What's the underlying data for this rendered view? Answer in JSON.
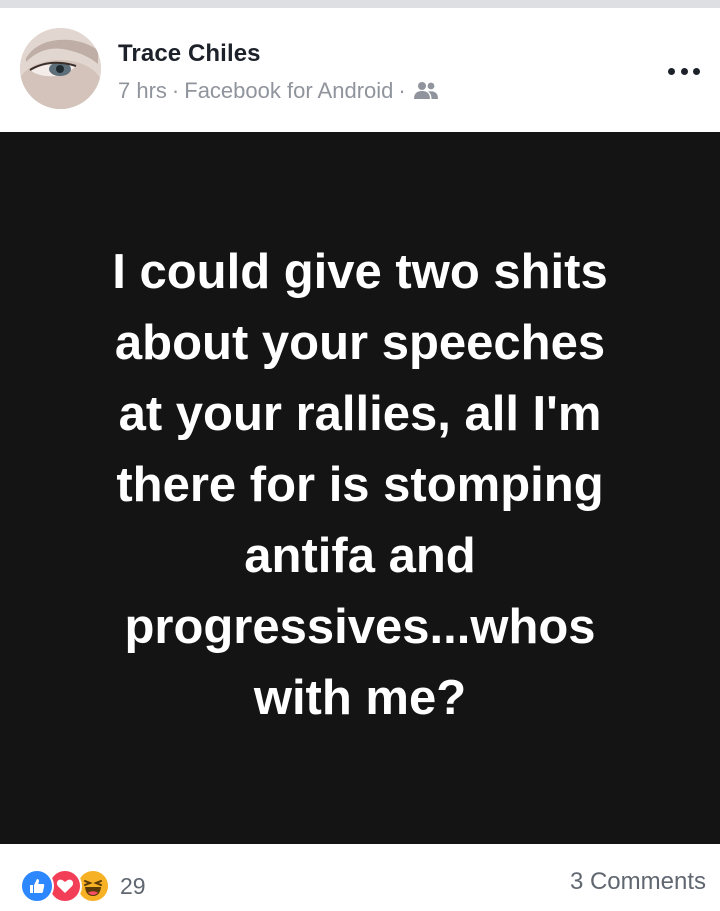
{
  "post": {
    "author_name": "Trace Chiles",
    "time": "7 hrs",
    "separator": "·",
    "source": "Facebook for Android",
    "audience_icon": "friends-icon",
    "more_icon": "more-options-icon",
    "text_lines": [
      "I could give two shits",
      "about your speeches",
      "at your rallies, all I'm",
      "there for is stomping",
      "antifa and",
      "progressives...whos",
      "with me?"
    ],
    "background_color": "#141414",
    "text_color": "#ffffff"
  },
  "footer": {
    "reactions": [
      "like-icon",
      "love-icon",
      "haha-icon"
    ],
    "reaction_count": "29",
    "comments_label": "3 Comments"
  },
  "colors": {
    "like": "#2d88ff",
    "love": "#f33e58",
    "haha": "#f7b125",
    "name": "#1d2129",
    "meta": "#90949c"
  }
}
